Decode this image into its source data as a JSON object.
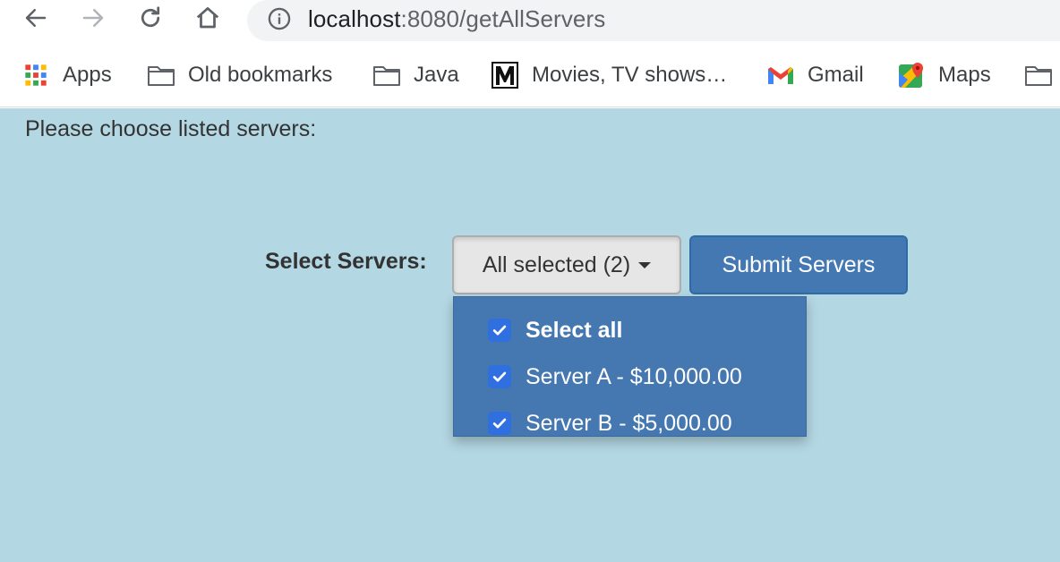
{
  "browser": {
    "nav": {
      "back_icon": "arrow-left-icon",
      "forward_icon": "arrow-right-icon",
      "reload_icon": "reload-icon",
      "home_icon": "home-icon"
    },
    "url": {
      "host": "localhost",
      "path": ":8080/getAllServers"
    }
  },
  "bookmarks": [
    {
      "label": "Apps",
      "icon": "apps-grid-icon"
    },
    {
      "label": "Old bookmarks",
      "icon": "folder-icon"
    },
    {
      "label": "Java",
      "icon": "folder-icon"
    },
    {
      "label": "Movies, TV shows…",
      "icon": "m-logo-icon"
    },
    {
      "label": "Gmail",
      "icon": "gmail-icon"
    },
    {
      "label": "Maps",
      "icon": "maps-icon"
    },
    {
      "label": "",
      "icon": "folder-icon"
    }
  ],
  "page": {
    "instruction": "Please choose listed servers:",
    "select_label": "Select Servers:",
    "dropdown_text": "All selected (2)",
    "submit_label": "Submit Servers",
    "options": [
      {
        "label": "Select all",
        "checked": true,
        "bold": true
      },
      {
        "label": "Server A - $10,000.00",
        "checked": true,
        "bold": false
      },
      {
        "label": "Server B - $5,000.00",
        "checked": true,
        "bold": false
      }
    ]
  },
  "colors": {
    "page_background": "#b3d7e3",
    "menu_background": "#4577b0",
    "submit_background": "#4478b2",
    "checkbox": "#2f6fe0"
  }
}
